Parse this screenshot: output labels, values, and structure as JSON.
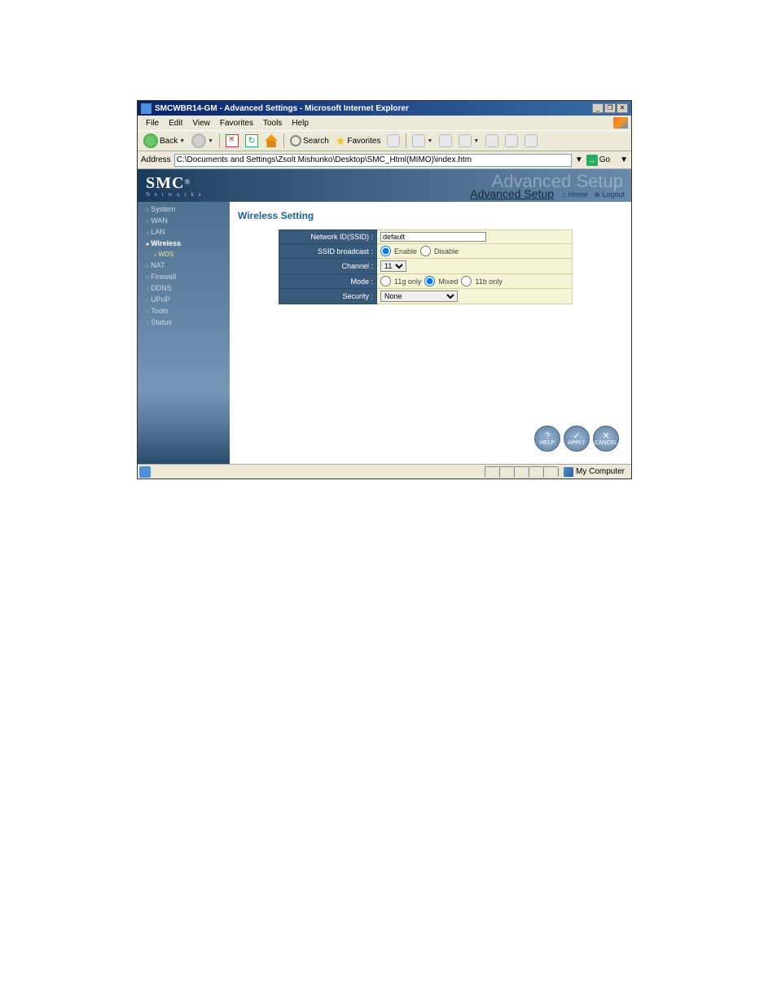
{
  "link_above": "",
  "window": {
    "title": "SMCWBR14-GM - Advanced Settings - Microsoft Internet Explorer",
    "min": "_",
    "max": "❐",
    "close": "✕"
  },
  "menubar": [
    "File",
    "Edit",
    "View",
    "Favorites",
    "Tools",
    "Help"
  ],
  "toolbar": {
    "back": "Back",
    "search": "Search",
    "favorites": "Favorites"
  },
  "addressbar": {
    "label": "Address",
    "value": "C:\\Documents and Settings\\Zsolt Mishunko\\Desktop\\SMC_Html(MIMO)\\index.htm",
    "go": "Go"
  },
  "banner": {
    "logo_main": "SMC",
    "logo_reg": "®",
    "logo_sub": "N e t w o r k s",
    "title_ghost": "Advanced Setup",
    "title_main": "Advanced Setup",
    "home": "Home",
    "logout": "Logout"
  },
  "sidebar": [
    {
      "label": "System",
      "active": false
    },
    {
      "label": "WAN",
      "active": false
    },
    {
      "label": "LAN",
      "active": false
    },
    {
      "label": "Wireless",
      "active": true
    },
    {
      "label": "WDS",
      "sub": true
    },
    {
      "label": "NAT",
      "active": false
    },
    {
      "label": "Firewall",
      "active": false
    },
    {
      "label": "DDNS",
      "active": false
    },
    {
      "label": "UPnP",
      "active": false
    },
    {
      "label": "Tools",
      "active": false
    },
    {
      "label": "Status",
      "active": false
    }
  ],
  "section_title": "Wireless Setting",
  "form": {
    "ssid_label": "Network ID(SSID) :",
    "ssid_value": "default",
    "broadcast_label": "SSID broadcast :",
    "broadcast_enable": "Enable",
    "broadcast_disable": "Disable",
    "channel_label": "Channel :",
    "channel_value": "11",
    "mode_label": "Mode :",
    "mode_11g": "11g only",
    "mode_mixed": "Mixed",
    "mode_11b": "11b only",
    "security_label": "Security :",
    "security_value": "None"
  },
  "buttons": {
    "help": "HELP",
    "apply": "APPLY",
    "cancel": "CANCEL"
  },
  "statusbar": {
    "zone": "My Computer"
  }
}
